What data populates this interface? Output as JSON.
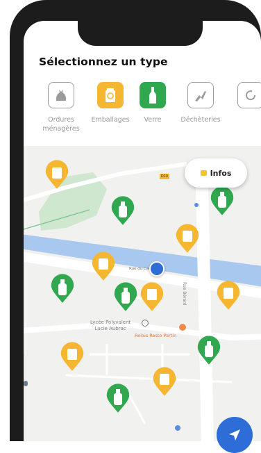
{
  "header": {
    "title": "Sélectionnez un type"
  },
  "types": [
    {
      "label_line1": "Ordures",
      "label_line2": "ménagères",
      "color": "#9b9b9b",
      "icon": "trash-bag-icon",
      "selected": false
    },
    {
      "label_line1": "Emballages",
      "label_line2": "",
      "color": "#f5b731",
      "icon": "recycling-bin-icon",
      "selected": true
    },
    {
      "label_line1": "Verre",
      "label_line2": "",
      "color": "#2fa84f",
      "icon": "glass-bottle-icon",
      "selected": true
    },
    {
      "label_line1": "Déchèteries",
      "label_line2": "",
      "color": "#9b9b9b",
      "icon": "dump-site-icon",
      "selected": false
    }
  ],
  "map": {
    "infos_label": "Infos",
    "labels": {
      "school_line1": "Lycée Polyvalent",
      "school_line2": "Lucie Aubrac",
      "restaurant": "Relais Resto Partin",
      "street_vertical": "Rue Bérard",
      "street_canal": "Rue du Canal",
      "road_badge": "D10"
    },
    "colors": {
      "glass_marker": "#2fa84f",
      "packaging_marker": "#f5b731",
      "canal": "#a9c8f0",
      "park": "#cfe6cf",
      "user_location": "#2e6cd8"
    }
  }
}
